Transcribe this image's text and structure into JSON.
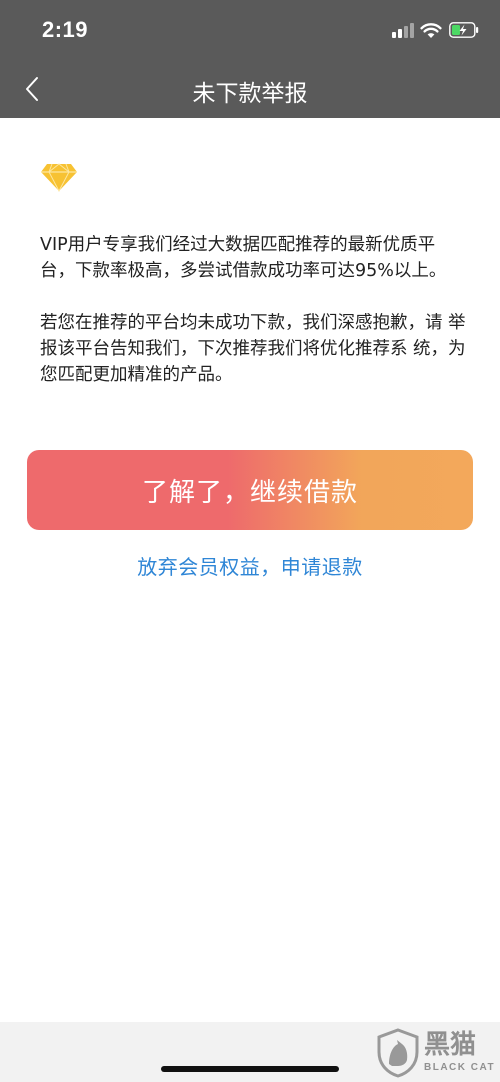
{
  "status_bar": {
    "time": "2:19"
  },
  "nav": {
    "title": "未下款举报"
  },
  "content": {
    "paragraph1": "VIP用户专享我们经过大数据匹配推荐的最新优质平 台，下款率极高，多尝试借款成功率可达95%以上。",
    "paragraph2": "若您在推荐的平台均未成功下款，我们深感抱歉，请 举报该平台告知我们，下次推荐我们将优化推荐系 统，为您匹配更加精准的产品。"
  },
  "actions": {
    "primary_label": "了解了，继续借款",
    "secondary_label": "放弃会员权益，申请退款"
  },
  "watermark": {
    "main": "黑猫",
    "sub": "BLACK CAT"
  },
  "colors": {
    "nav_background": "#5a5a5a",
    "button_gradient_start": "#ee6a6c",
    "button_gradient_end": "#f3a85b",
    "link": "#2f86d6",
    "diamond": "#f7c233"
  },
  "icons": {
    "back": "chevron-left-icon",
    "vip": "diamond-icon",
    "signal": "cellular-signal-icon",
    "wifi": "wifi-icon",
    "battery": "battery-charging-icon"
  }
}
